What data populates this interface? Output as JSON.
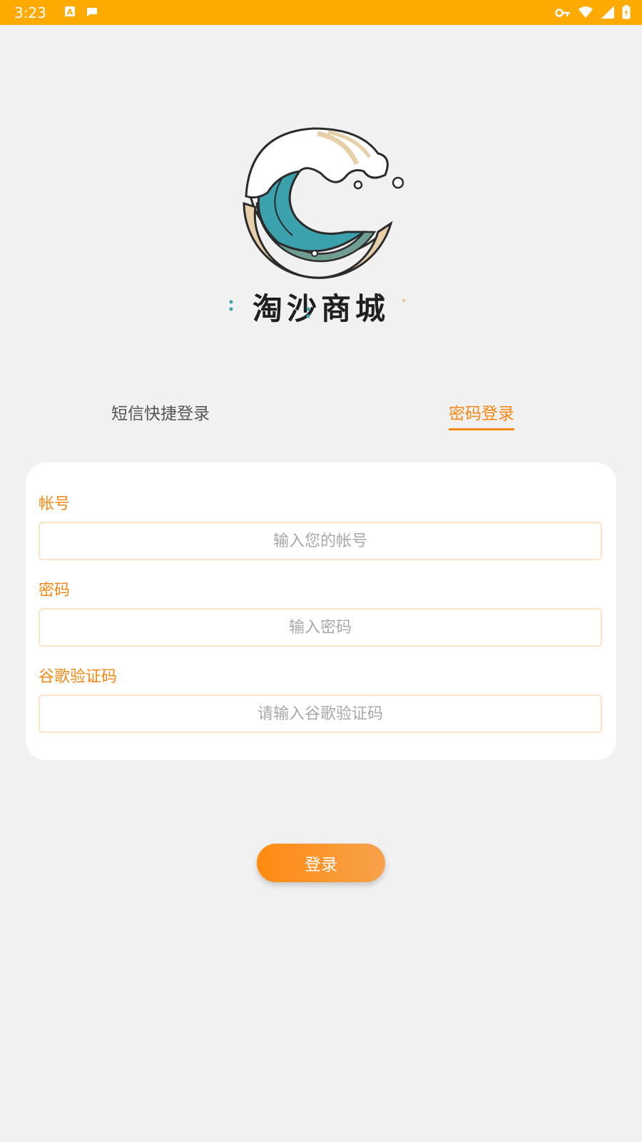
{
  "status_bar": {
    "time": "3:23",
    "left_icons": [
      "app-a-icon",
      "notification-icon"
    ],
    "right_icons": [
      "vpn-key-icon",
      "wifi-icon",
      "signal-icon",
      "battery-icon"
    ]
  },
  "logo": {
    "brand_text": "淘沙商城"
  },
  "tabs": [
    {
      "label": "短信快捷登录",
      "active": false
    },
    {
      "label": "密码登录",
      "active": true
    }
  ],
  "form": {
    "account": {
      "label": "帐号",
      "placeholder": "输入您的帐号",
      "value": ""
    },
    "password": {
      "label": "密码",
      "placeholder": "输入密码",
      "value": ""
    },
    "google_code": {
      "label": "谷歌验证码",
      "placeholder": "请输入谷歌验证码",
      "value": ""
    }
  },
  "login_button": {
    "label": "登录"
  },
  "colors": {
    "status_bar": "#ffaa00",
    "accent": "#f68712",
    "input_border": "#fde4c4",
    "background": "#f1f1f1"
  }
}
